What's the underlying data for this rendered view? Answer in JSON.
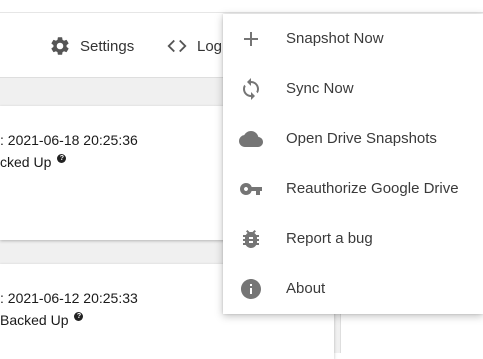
{
  "toolbar": {
    "settings_label": "Settings",
    "logs_label": "Log"
  },
  "snapshots": [
    {
      "date": ": 2021-06-18 20:25:36",
      "status": "cked Up"
    },
    {
      "date": ": 2021-06-12 20:25:33",
      "status": "Backed Up"
    }
  ],
  "menu": {
    "items": [
      {
        "label": "Snapshot Now",
        "icon": "plus-icon"
      },
      {
        "label": "Sync Now",
        "icon": "sync-icon"
      },
      {
        "label": "Open Drive Snapshots",
        "icon": "cloud-icon"
      },
      {
        "label": "Reauthorize Google Drive",
        "icon": "key-icon"
      },
      {
        "label": "Report a bug",
        "icon": "bug-icon"
      },
      {
        "label": "About",
        "icon": "info-icon"
      }
    ]
  },
  "colors": {
    "icon": "#757575",
    "text": "#3a3a3a",
    "background": "#f0f0f0"
  }
}
